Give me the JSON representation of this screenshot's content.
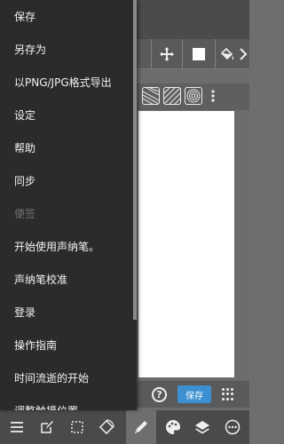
{
  "menu": {
    "items": [
      {
        "label": "保存",
        "enabled": true
      },
      {
        "label": "另存为",
        "enabled": true
      },
      {
        "label": "以PNG/JPG格式导出",
        "enabled": true
      },
      {
        "label": "设定",
        "enabled": true
      },
      {
        "label": "帮助",
        "enabled": true
      },
      {
        "label": "同步",
        "enabled": true
      },
      {
        "label": "便签",
        "enabled": false
      },
      {
        "label": "开始使用声纳笔。",
        "enabled": true
      },
      {
        "label": "声纳笔校准",
        "enabled": true
      },
      {
        "label": "登录",
        "enabled": true
      },
      {
        "label": "操作指南",
        "enabled": true
      },
      {
        "label": "时间流逝的开始",
        "enabled": true
      },
      {
        "label": "调整触摸位置",
        "enabled": true
      }
    ]
  },
  "statusbar": {
    "help_label": "?",
    "save_label": "保存"
  },
  "colors": {
    "menu_bg": "#2b2b2b",
    "save_button": "#3c8fd0",
    "canvas": "#ffffff"
  },
  "icons": {
    "toolbar": [
      "move-icon",
      "fill-color-square-icon",
      "paint-bucket-icon",
      "chevron-right-icon"
    ],
    "brushes": [
      "brush-lines-icon",
      "brush-hatch-icon",
      "brush-circle-icon",
      "more-vert-icon"
    ],
    "bottom": [
      "menu-icon",
      "edit-icon",
      "selection-icon",
      "rotate-icon",
      "pen-icon",
      "palette-icon",
      "layers-icon",
      "more-icon"
    ]
  }
}
